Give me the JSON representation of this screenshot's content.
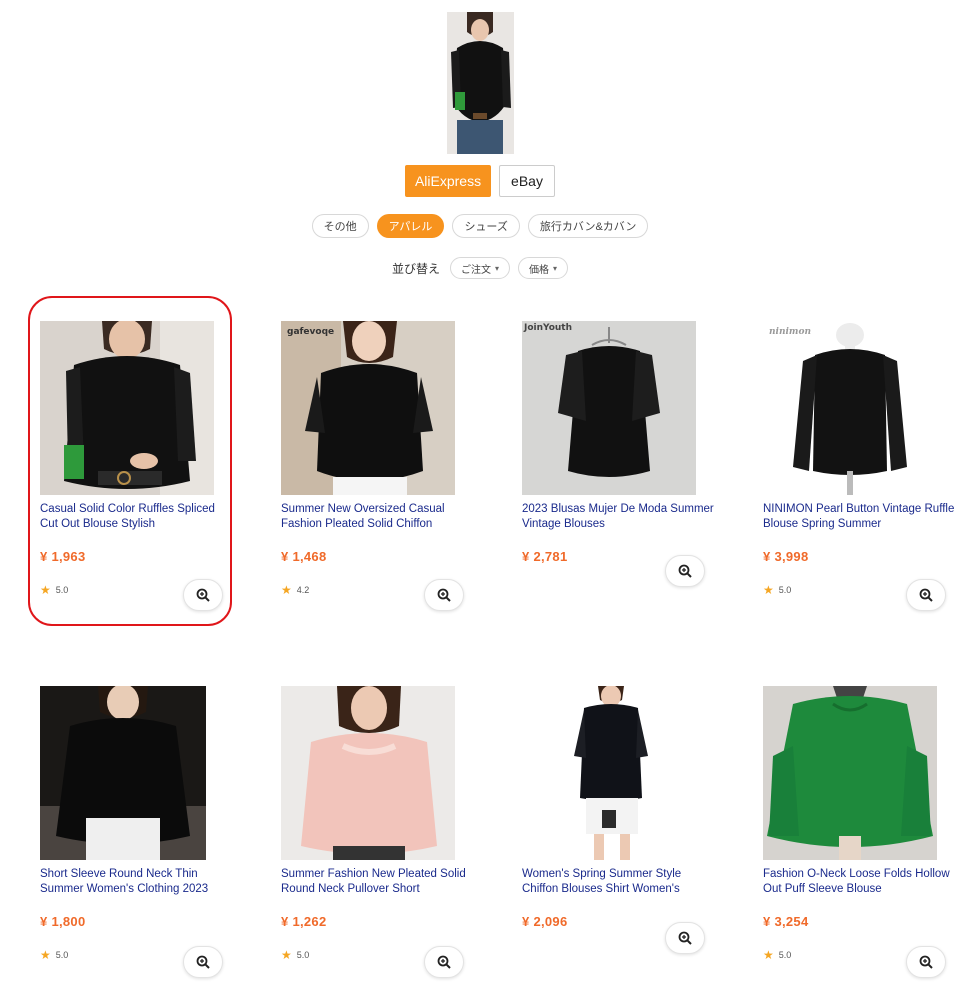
{
  "sources": {
    "tabs": [
      {
        "label": "AliExpress",
        "active": true
      },
      {
        "label": "eBay",
        "active": false
      }
    ]
  },
  "categories": [
    {
      "label": "その他",
      "active": false
    },
    {
      "label": "アパレル",
      "active": true
    },
    {
      "label": "シューズ",
      "active": false
    },
    {
      "label": "旅行カバン&カバン",
      "active": false
    }
  ],
  "sort": {
    "label": "並び替え",
    "options": [
      "ご注文",
      "価格"
    ]
  },
  "products": [
    {
      "title": "Casual Solid Color Ruffles Spliced Cut Out Blouse Stylish",
      "price": "¥ 1,963",
      "rating": "5.0"
    },
    {
      "title": "Summer New Oversized Casual Fashion Pleated Solid Chiffon",
      "price": "¥ 1,468",
      "rating": "4.2",
      "brand": "gafevoqe"
    },
    {
      "title": "2023 Blusas Mujer De Moda Summer Vintage Blouses",
      "price": "¥ 2,781",
      "rating": "",
      "brand": "JoinYouth"
    },
    {
      "title": "NINIMON Pearl Button Vintage Ruffle Blouse Spring Summer",
      "price": "¥ 3,998",
      "rating": "5.0",
      "brand": "ninimon"
    },
    {
      "title": "Short Sleeve Round Neck Thin Summer Women's Clothing 2023",
      "price": "¥ 1,800",
      "rating": "5.0"
    },
    {
      "title": "Summer Fashion New Pleated Solid Round Neck Pullover Short",
      "price": "¥ 1,262",
      "rating": "5.0"
    },
    {
      "title": "Women's Spring Summer Style Chiffon Blouses Shirt Women's",
      "price": "¥ 2,096",
      "rating": ""
    },
    {
      "title": "Fashion O-Neck Loose Folds Hollow Out Puff Sleeve Blouse",
      "price": "¥ 3,254",
      "rating": "5.0"
    }
  ]
}
